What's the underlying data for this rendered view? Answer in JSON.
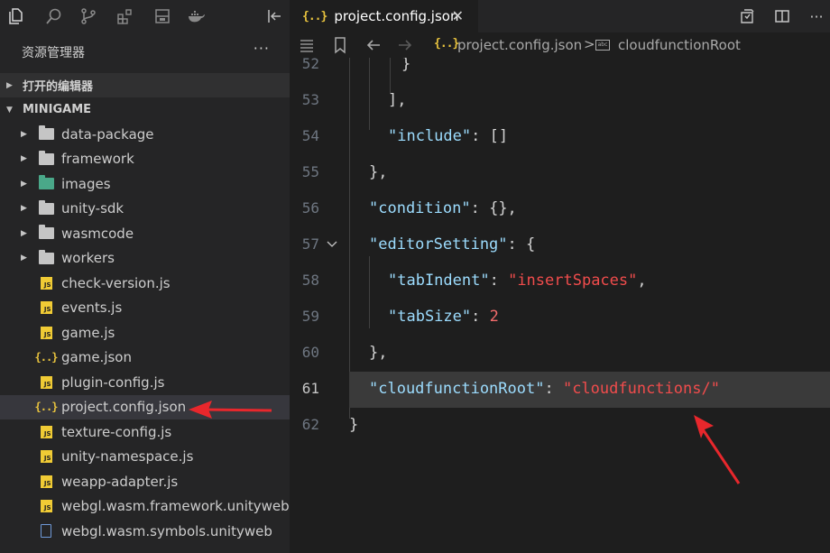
{
  "explorer": {
    "title": "资源管理器",
    "more": "···",
    "open_editors_label": "打开的编辑器",
    "project_label": "MINIGAME",
    "items": [
      {
        "label": "data-package",
        "type": "folder"
      },
      {
        "label": "framework",
        "type": "folder"
      },
      {
        "label": "images",
        "type": "folder-images"
      },
      {
        "label": "unity-sdk",
        "type": "folder"
      },
      {
        "label": "wasmcode",
        "type": "folder"
      },
      {
        "label": "workers",
        "type": "folder"
      },
      {
        "label": "check-version.js",
        "type": "js"
      },
      {
        "label": "events.js",
        "type": "js"
      },
      {
        "label": "game.js",
        "type": "js"
      },
      {
        "label": "game.json",
        "type": "json"
      },
      {
        "label": "plugin-config.js",
        "type": "js"
      },
      {
        "label": "project.config.json",
        "type": "json",
        "selected": true
      },
      {
        "label": "texture-config.js",
        "type": "js"
      },
      {
        "label": "unity-namespace.js",
        "type": "js"
      },
      {
        "label": "weapp-adapter.js",
        "type": "js"
      },
      {
        "label": "webgl.wasm.framework.unityweb.js",
        "type": "js"
      },
      {
        "label": "webgl.wasm.symbols.unityweb",
        "type": "file"
      }
    ]
  },
  "tab": {
    "icon": "{..}",
    "title": "project.config.json",
    "close": "✕"
  },
  "breadcrumb": {
    "file_icon": "{..}",
    "file": "project.config.json",
    "separator": ">",
    "property_icon": "abc",
    "property": "cloudfunctionRoot"
  },
  "code": {
    "lines": [
      {
        "num": "52",
        "text": "}"
      },
      {
        "num": "53",
        "text": "],"
      },
      {
        "num": "54",
        "key": "\"include\"",
        "sep": ": ",
        "rest": "[]"
      },
      {
        "num": "55",
        "text": "},"
      },
      {
        "num": "56",
        "key": "\"condition\"",
        "sep": ": ",
        "rest": "{},"
      },
      {
        "num": "57",
        "key": "\"editorSetting\"",
        "sep": ": ",
        "rest": "{"
      },
      {
        "num": "58",
        "key": "\"tabIndent\"",
        "sep": ": ",
        "value": "\"insertSpaces\"",
        "tail": ","
      },
      {
        "num": "59",
        "key": "\"tabSize\"",
        "sep": ": ",
        "number": "2"
      },
      {
        "num": "60",
        "text": "},"
      },
      {
        "num": "61",
        "key": "\"cloudfunctionRoot\"",
        "sep": ": ",
        "value": "\"cloudfunctions/\""
      },
      {
        "num": "62",
        "text": "}"
      }
    ]
  },
  "colors": {
    "annotation_arrow": "#e8272c",
    "json_icon": "#e8c33e",
    "js_badge": "#f0cb35",
    "key": "#9cdcfe",
    "string": "#f14c4c"
  }
}
